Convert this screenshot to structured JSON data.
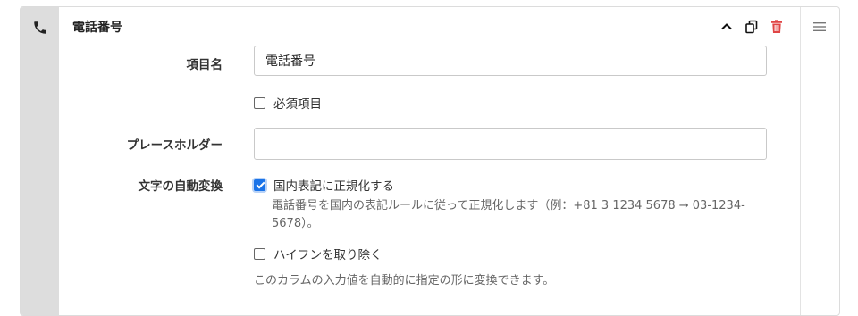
{
  "field": {
    "type_icon": "phone-icon",
    "title": "電話番号",
    "header_actions": {
      "collapse_icon": "chevron-up-icon",
      "duplicate_icon": "copy-icon",
      "delete_icon": "trash-icon",
      "delete_color": "#e04545"
    },
    "drag_icon": "menu-icon"
  },
  "form": {
    "item_name": {
      "label": "項目名",
      "value": "電話番号"
    },
    "required": {
      "label": "必須項目",
      "checked": false
    },
    "placeholder": {
      "label": "プレースホルダー",
      "value": ""
    },
    "auto_convert": {
      "label": "文字の自動変換",
      "normalize": {
        "label": "国内表記に正規化する",
        "checked": true,
        "description": "電話番号を国内の表記ルールに従って正規化します（例：+81 3 1234 5678 → 03-1234-5678）。"
      },
      "remove_hyphen": {
        "label": "ハイフンを取り除く",
        "checked": false
      },
      "help": "このカラムの入力値を自動的に指定の形に変換できます。"
    }
  },
  "colors": {
    "accent": "#1a73e8",
    "sidebar": "#dddddd"
  }
}
